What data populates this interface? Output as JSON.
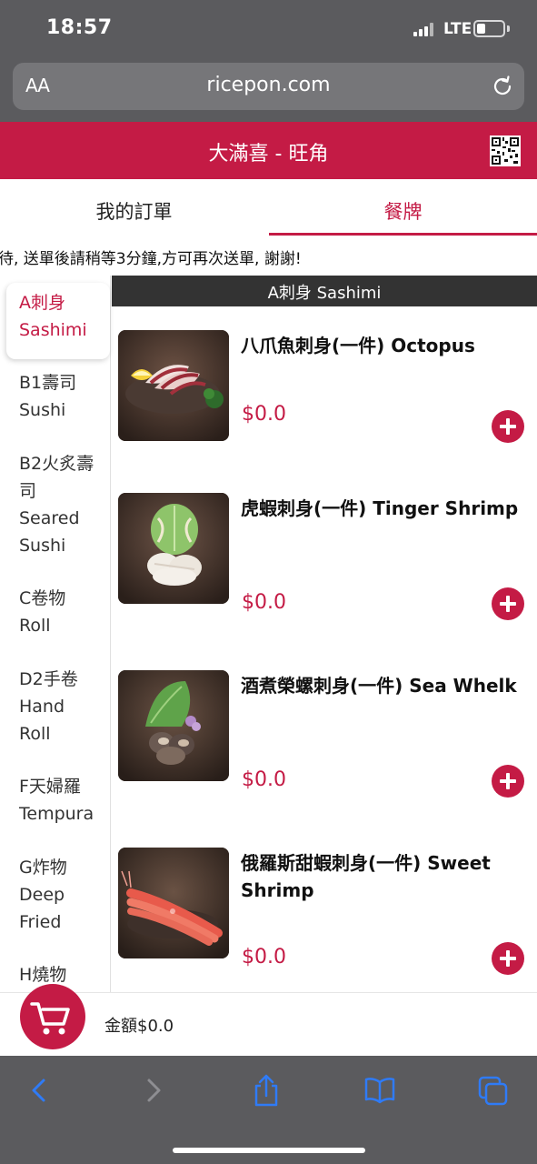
{
  "status_bar": {
    "time": "18:57",
    "network": "LTE"
  },
  "browser": {
    "aa_label": "AA",
    "url": "ricepon.com"
  },
  "header": {
    "title": "大滿喜 - 旺角"
  },
  "tabs": [
    {
      "label": "我的訂單"
    },
    {
      "label": "餐牌"
    }
  ],
  "notice": "待, 送單後請稍等3分鐘,方可再次送單, 謝謝!",
  "categories": [
    {
      "line1": "A刺身",
      "line2": "Sashimi"
    },
    {
      "line1": "B1壽司",
      "line2": "Sushi"
    },
    {
      "line1": "B2火炙壽",
      "line2": "司",
      "line3": "Seared",
      "line4": "Sushi"
    },
    {
      "line1": "C卷物",
      "line2": "Roll"
    },
    {
      "line1": "D2手卷",
      "line2": "Hand",
      "line3": "Roll"
    },
    {
      "line1": "F天婦羅",
      "line2": "Tempura"
    },
    {
      "line1": "G炸物",
      "line2": "Deep",
      "line3": "Fried"
    },
    {
      "line1": "H燒物"
    }
  ],
  "section_title": "A刺身 Sashimi",
  "items": [
    {
      "name": "八爪魚刺身(一件) Octopus",
      "price": "$0.0"
    },
    {
      "name": "虎蝦刺身(一件) Tinger Shrimp",
      "price": "$0.0"
    },
    {
      "name": "酒煮榮螺刺身(一件) Sea Whelk",
      "price": "$0.0"
    },
    {
      "name": "俄羅斯甜蝦刺身(一件) Sweet Shrimp",
      "price": "$0.0"
    }
  ],
  "cart": {
    "total_label": "金額$0.0"
  },
  "colors": {
    "brand": "#c41b45",
    "chrome": "#5b5b5e",
    "ios_blue": "#2f7bf6"
  },
  "icons": [
    "reload-icon",
    "qr-code-icon",
    "cart-icon",
    "back-icon",
    "forward-icon",
    "share-icon",
    "bookmarks-icon",
    "tabs-icon"
  ]
}
